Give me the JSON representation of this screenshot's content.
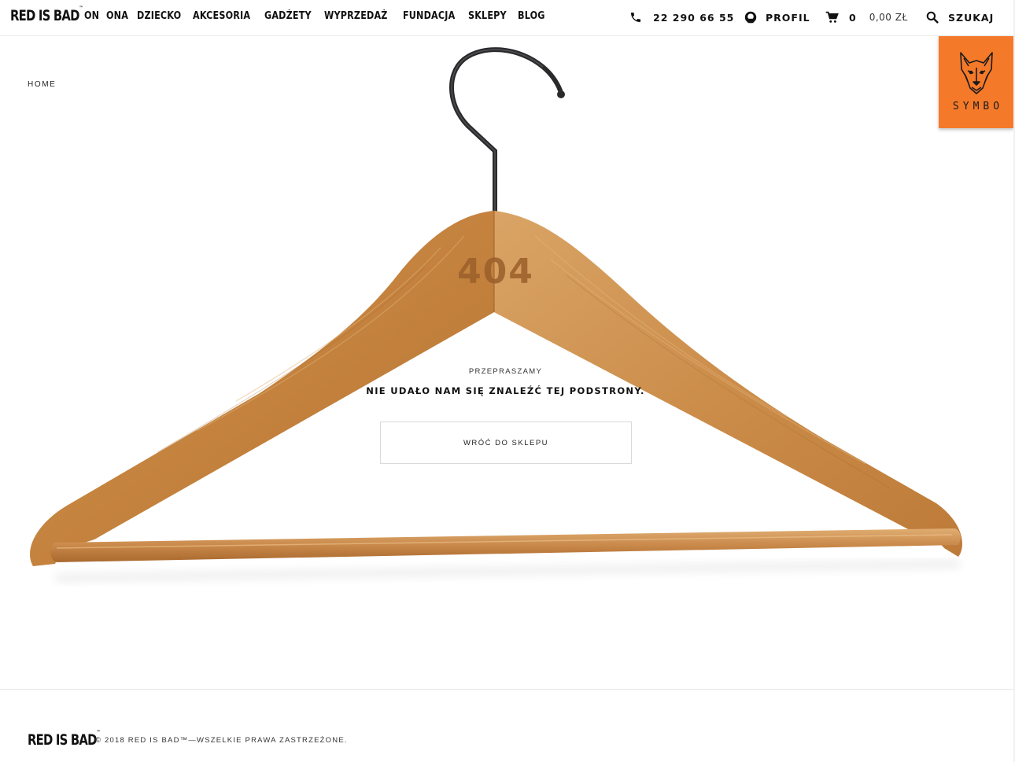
{
  "brand": {
    "logo": "RED IS BAD",
    "tm": "™"
  },
  "nav": {
    "items": [
      "ON",
      "ONA",
      "DZIECKO",
      "AKCESORIA",
      "GADŻETY",
      "WYPRZEDAŻ",
      "FUNDACJA",
      "SKLEPY",
      "BLOG"
    ]
  },
  "header": {
    "phone": "22 290 66 55",
    "profile_label": "PROFIL",
    "cart_count": "0",
    "cart_total": "0,00 ZŁ",
    "search_label": "SZUKAJ"
  },
  "symbo": {
    "label": "SYMBO",
    "accent": "#f47a2a"
  },
  "breadcrumb": {
    "home": "HOME"
  },
  "error": {
    "code": "404",
    "title": "PRZEPRASZAMY",
    "message": "NIE UDAŁO NAM SIĘ ZNALEŹĆ TEJ PODSTRONY.",
    "button": "WRÓĆ DO SKLEPU"
  },
  "footer": {
    "copyright": "© 2018 RED IS BAD™—WSZELKIE PRAWA ZASTRZEŻONE."
  },
  "icons": [
    "phone-icon",
    "profile-icon",
    "cart-icon",
    "search-icon",
    "wolf-icon"
  ]
}
